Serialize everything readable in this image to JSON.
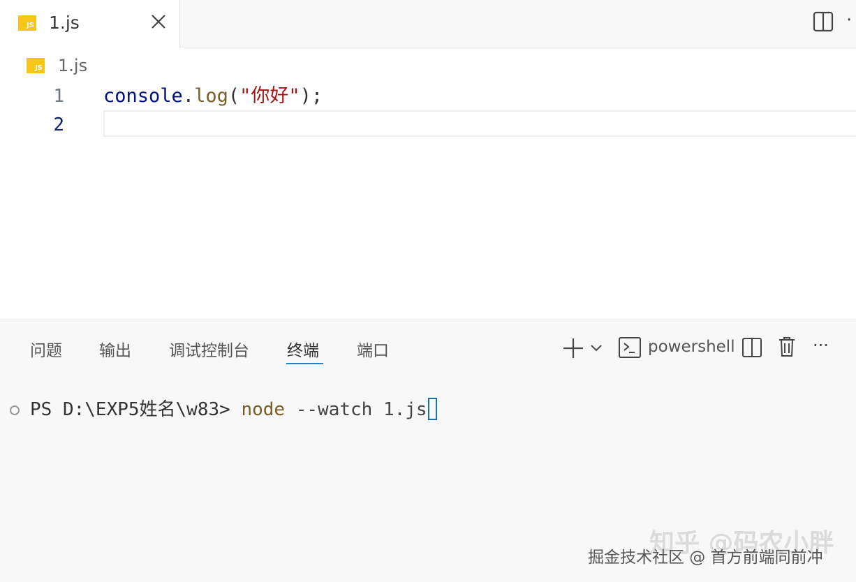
{
  "tab": {
    "label": "1.js",
    "icon": "js-file-icon",
    "icon_text": "JS"
  },
  "breadcrumb": {
    "file": "1.js"
  },
  "editor": {
    "lines": [
      {
        "number": "1",
        "tokens": {
          "ident": "console",
          "dot": ".",
          "fn": "log",
          "open": "(",
          "str": "\"你好\"",
          "close": ");"
        }
      },
      {
        "number": "2"
      }
    ]
  },
  "panel": {
    "tabs": [
      "问题",
      "输出",
      "调试控制台",
      "终端",
      "端口"
    ],
    "active_tab": "终端",
    "shell": "powershell",
    "more": "···"
  },
  "terminal": {
    "prompt": "PS D:\\EXP5姓名\\w83> ",
    "command": "node",
    "args": " --watch 1.js"
  },
  "watermark": {
    "text": "掘金技术社区 @ 首方前端同前冲",
    "overlay": "知乎 @码农小胖"
  },
  "colors": {
    "accent": "#1a85c8",
    "js_icon": "#f5c518",
    "fn_token": "#795e26",
    "string_token": "#a31515",
    "ident_token": "#001080"
  }
}
